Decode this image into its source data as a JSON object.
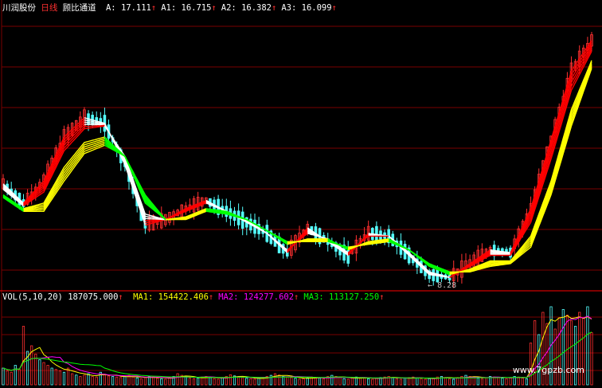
{
  "header": {
    "stock": "川润股份",
    "period": "日线",
    "indicator": "顾比通道",
    "items": [
      {
        "label": "A:",
        "value": "17.111",
        "arrow": "↑",
        "color": "#ffffff"
      },
      {
        "label": "A1:",
        "value": "16.715",
        "arrow": "↑",
        "color": "#ffffff"
      },
      {
        "label": "A2:",
        "value": "16.382",
        "arrow": "↑",
        "color": "#ffffff"
      },
      {
        "label": "A3:",
        "value": "16.099",
        "arrow": "↑",
        "color": "#ffffff"
      }
    ]
  },
  "volume_header": {
    "label": "VOL(5,10,20)",
    "value": "187075.000",
    "arrow": "↑",
    "items": [
      {
        "label": "MA1:",
        "value": "154422.406",
        "arrow": "↑",
        "color": "#ffff00"
      },
      {
        "label": "MA2:",
        "value": "124277.602",
        "arrow": "↑",
        "color": "#ff00ff"
      },
      {
        "label": "MA3:",
        "value": "113127.250",
        "arrow": "↑",
        "color": "#00ff00"
      }
    ]
  },
  "annotation": "8.28",
  "watermark": "www.7gpzb.com",
  "colors": {
    "background": "#000000",
    "grid": "#7a0000",
    "up_candle": "#ff3030",
    "down_candle": "#54ffff",
    "short_band": "#ff0000",
    "short_band_alt": "#ffffff",
    "long_band": "#ffff00",
    "long_band_alt": "#00ff00",
    "accent_red": "#ff0000"
  },
  "chart_data": [
    {
      "type": "line",
      "series": [
        {
          "name": "A",
          "x": [
            0,
            5,
            10,
            15,
            20,
            25,
            30,
            35,
            40,
            45,
            50,
            55,
            60,
            65,
            70,
            75,
            80,
            85,
            90,
            95,
            100,
            105,
            110,
            115,
            120,
            125,
            130,
            135,
            140,
            145
          ],
          "values": [
            11.9,
            11.2,
            12.0,
            13.6,
            14.3,
            14.1,
            12.6,
            10.4,
            10.6,
            11.0,
            11.3,
            10.9,
            10.5,
            10.1,
            9.4,
            10.3,
            9.8,
            9.3,
            10.1,
            10.0,
            9.3,
            8.6,
            8.5,
            9.0,
            9.5,
            9.4,
            11.0,
            13.5,
            16.0,
            17.111
          ]
        },
        {
          "name": "A1",
          "x": [
            0,
            5,
            10,
            15,
            20,
            25,
            30,
            35,
            40,
            45,
            50,
            55,
            60,
            65,
            70,
            75,
            80,
            85,
            90,
            95,
            100,
            105,
            110,
            115,
            120,
            125,
            130,
            135,
            140,
            145
          ],
          "values": [
            11.7,
            11.1,
            11.6,
            13.1,
            13.9,
            14.0,
            12.9,
            10.8,
            10.6,
            10.9,
            11.2,
            10.9,
            10.6,
            10.1,
            9.5,
            10.1,
            9.9,
            9.4,
            10.0,
            10.0,
            9.4,
            8.7,
            8.5,
            8.9,
            9.3,
            9.3,
            10.5,
            12.8,
            15.3,
            16.715
          ]
        },
        {
          "name": "A2",
          "x": [
            0,
            5,
            10,
            15,
            20,
            25,
            30,
            35,
            40,
            45,
            50,
            55,
            60,
            65,
            70,
            75,
            80,
            85,
            90,
            95,
            100,
            105,
            110,
            115,
            120,
            125,
            130,
            135,
            140,
            145
          ],
          "values": [
            11.5,
            11.0,
            11.2,
            12.5,
            13.4,
            13.6,
            12.9,
            11.2,
            10.6,
            10.7,
            11.0,
            10.9,
            10.6,
            10.2,
            9.7,
            9.9,
            9.9,
            9.5,
            9.8,
            9.9,
            9.5,
            8.9,
            8.6,
            8.8,
            9.1,
            9.1,
            10.0,
            12.0,
            14.6,
            16.382
          ]
        },
        {
          "name": "A3",
          "x": [
            0,
            5,
            10,
            15,
            20,
            25,
            30,
            35,
            40,
            45,
            50,
            55,
            60,
            65,
            70,
            75,
            80,
            85,
            90,
            95,
            100,
            105,
            110,
            115,
            120,
            125,
            130,
            135,
            140,
            145
          ],
          "values": [
            11.4,
            10.9,
            10.9,
            12.0,
            13.0,
            13.3,
            12.9,
            11.5,
            10.6,
            10.6,
            10.9,
            10.8,
            10.6,
            10.2,
            9.8,
            9.8,
            9.8,
            9.6,
            9.7,
            9.8,
            9.5,
            9.0,
            8.7,
            8.7,
            8.9,
            9.0,
            9.6,
            11.5,
            14.0,
            16.099
          ]
        }
      ],
      "ylim": [
        8.1,
        18.0
      ],
      "xlim": [
        0,
        145
      ],
      "min_marker": 8.28
    },
    {
      "type": "bar",
      "series": [
        {
          "name": "VOL",
          "values_latest": 187075.0
        },
        {
          "name": "MA1",
          "latest": 154422.406
        },
        {
          "name": "MA2",
          "latest": 124277.602
        },
        {
          "name": "MA3",
          "latest": 113127.25
        }
      ],
      "volumes": [
        60,
        50,
        45,
        70,
        55,
        210,
        120,
        140,
        110,
        90,
        80,
        70,
        60,
        55,
        50,
        45,
        60,
        40,
        35,
        30,
        35,
        40,
        30,
        28,
        45,
        38,
        32,
        30,
        28,
        26,
        30,
        34,
        28,
        25,
        22,
        26,
        30,
        28,
        24,
        22,
        20,
        26,
        30,
        40,
        34,
        28,
        24,
        22,
        25,
        28,
        30,
        26,
        22,
        20,
        24,
        30,
        36,
        32,
        28,
        26,
        24,
        22,
        20,
        24,
        26,
        30,
        34,
        40,
        35,
        30,
        28,
        26,
        24,
        20,
        22,
        25,
        28,
        26,
        24,
        22,
        30,
        34,
        30,
        26,
        22,
        20,
        24,
        28,
        26,
        24,
        22,
        20,
        24,
        26,
        28,
        30,
        26,
        22,
        20,
        24,
        26,
        28,
        24,
        22,
        20,
        22,
        24,
        28,
        30,
        26,
        22,
        20,
        26,
        30,
        34,
        30,
        26,
        24,
        22,
        26,
        30,
        28,
        26,
        24,
        22,
        26,
        30,
        28,
        24,
        22,
        150,
        230,
        180,
        260,
        220,
        280,
        200,
        240,
        270,
        250,
        230,
        210,
        260,
        240,
        280,
        187
      ]
    }
  ]
}
